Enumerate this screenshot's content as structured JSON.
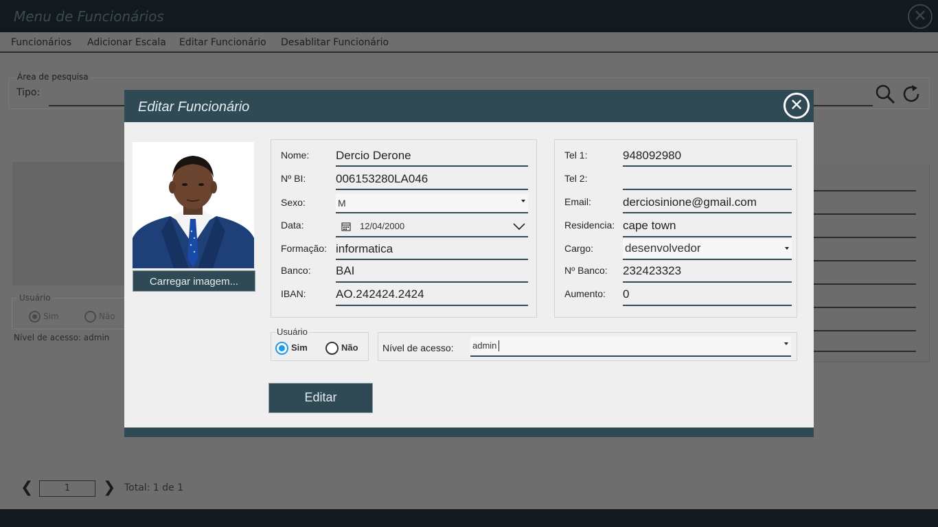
{
  "window": {
    "title": "Menu de Funcionários",
    "close_symbol": "✕"
  },
  "menu": {
    "items": [
      "Funcionários",
      "Adicionar Escala",
      "Editar Funcionário",
      "Desablitar Funcionário"
    ]
  },
  "search": {
    "legend": "Área de pesquisa",
    "tipo_label": "Tipo:"
  },
  "background_form": {
    "usuario_legend": "Usuário",
    "sim_label": "Sim",
    "nao_label": "Não",
    "nivel_text": "Nível de acesso: admin"
  },
  "pager": {
    "prev_symbol": "❮",
    "page": "1",
    "next_symbol": "❯",
    "total": "Total: 1 de 1"
  },
  "modal": {
    "title": "Editar Funcionário",
    "close_symbol": "✕",
    "upload_label": "Carregar imagem...",
    "left_fields": {
      "nome_label": "Nome:",
      "nome_value": "Dercio Derone",
      "bi_label": "Nº BI:",
      "bi_value": "006153280LA046",
      "sexo_label": "Sexo:",
      "sexo_value": "M",
      "data_label": "Data:",
      "data_value": "12/04/2000",
      "formacao_label": "Formação:",
      "formacao_value": "informatica",
      "banco_label": "Banco:",
      "banco_value": "BAI",
      "iban_label": "IBAN:",
      "iban_value": "AO.242424.2424"
    },
    "right_fields": {
      "tel1_label": "Tel 1:",
      "tel1_value": "948092980",
      "tel2_label": "Tel 2:",
      "tel2_value": "",
      "email_label": "Email:",
      "email_value": "derciosinione@gmail.com",
      "residencia_label": "Residencia:",
      "residencia_value": "cape town",
      "cargo_label": "Cargo:",
      "cargo_value": "desenvolvedor",
      "nbanco_label": "Nº Banco:",
      "nbanco_value": "232423323",
      "aumento_label": "Aumento:",
      "aumento_value": "0"
    },
    "usuario": {
      "legend": "Usuário",
      "sim_label": "Sim",
      "nao_label": "Não",
      "selected": "Sim"
    },
    "nivel": {
      "label": "Nível de acesso:",
      "value": "admin"
    },
    "submit_label": "Editar"
  },
  "colors": {
    "accent": "#2f4a55",
    "radio_selected": "#1e9be8",
    "dark_bar": "#121a20"
  }
}
